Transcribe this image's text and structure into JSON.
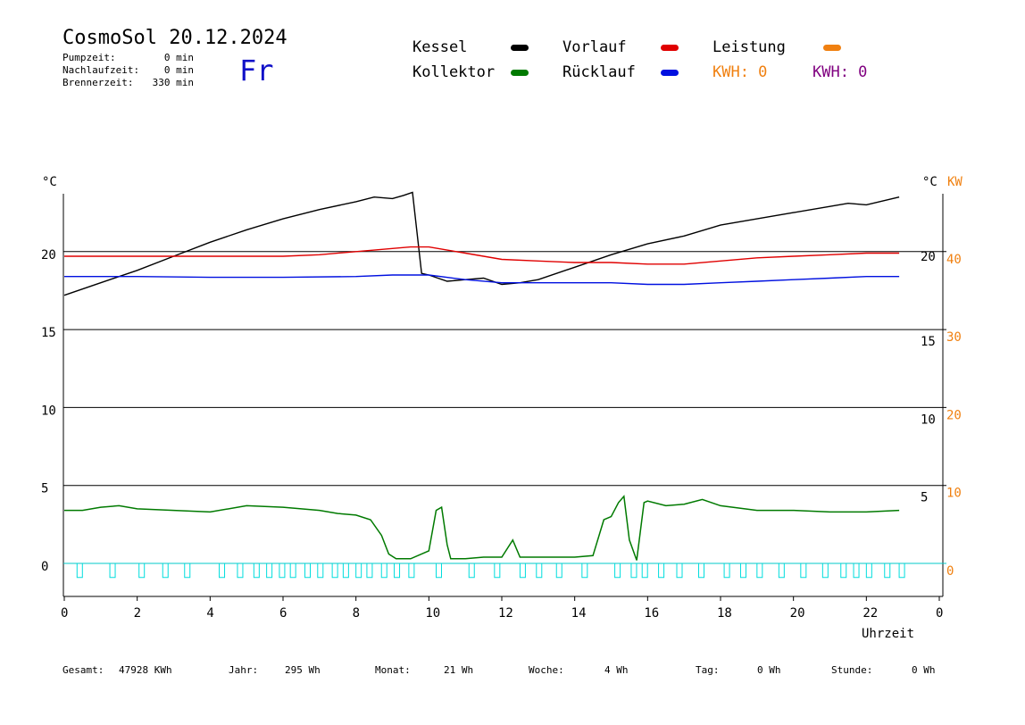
{
  "header": {
    "title": "CosmoSol 20.12.2024",
    "day": "Fr",
    "stats": [
      {
        "label": "Pumpzeit:",
        "value": "0 min"
      },
      {
        "label": "Nachlaufzeit:",
        "value": "0 min"
      },
      {
        "label": "Brennerzeit:",
        "value": "330 min"
      }
    ]
  },
  "legend": {
    "kessel": {
      "label": "Kessel",
      "color": "#000000"
    },
    "vorlauf": {
      "label": "Vorlauf",
      "color": "#e00000"
    },
    "leistung": {
      "label": "Leistung",
      "color": "#f08010"
    },
    "kollektor": {
      "label": "Kollektor",
      "color": "#007a00"
    },
    "ruecklauf": {
      "label": "Rücklauf",
      "color": "#0010e0"
    },
    "kwh_orange": {
      "label": "KWH: 0",
      "color": "#f08010"
    },
    "kwh_purple": {
      "label": "KWH: 0",
      "color": "#800080"
    }
  },
  "footer": [
    {
      "label": "Gesamt:",
      "value": "47928 KWh"
    },
    {
      "label": "Jahr:",
      "value": "295 Wh"
    },
    {
      "label": "Monat:",
      "value": "21 Wh"
    },
    {
      "label": "Woche:",
      "value": "4 Wh"
    },
    {
      "label": "Tag:",
      "value": "0 Wh"
    },
    {
      "label": "Stunde:",
      "value": "0 Wh"
    }
  ],
  "chart_data": {
    "type": "line",
    "xlabel": "Uhrzeit",
    "xlim": [
      0,
      24
    ],
    "x_ticks": [
      "0",
      "2",
      "4",
      "6",
      "8",
      "10",
      "12",
      "14",
      "16",
      "18",
      "20",
      "22",
      "0"
    ],
    "left_axis": {
      "unit": "°C",
      "ticks": [
        "0",
        "5",
        "10",
        "15",
        "20"
      ],
      "ylim": [
        0,
        25
      ]
    },
    "right_axis_scaled": {
      "unit": "°C",
      "note_ticks": [
        "5",
        "10",
        "15",
        "20"
      ]
    },
    "right_axis_kw": {
      "unit": "KW",
      "ticks": [
        "0",
        "10",
        "20",
        "30",
        "40"
      ]
    },
    "series": [
      {
        "name": "Kessel",
        "color": "#000000",
        "x": [
          0,
          0.5,
          1,
          2,
          3,
          4,
          5,
          6,
          7,
          8,
          8.5,
          9,
          9.3,
          9.55,
          9.8,
          10,
          10.5,
          11,
          11.5,
          12,
          12.5,
          13,
          14,
          15,
          16,
          17,
          18,
          19,
          20,
          21,
          21.5,
          22,
          22.9
        ],
        "y": [
          17.2,
          17.6,
          18.0,
          18.8,
          19.7,
          20.6,
          21.4,
          22.1,
          22.7,
          23.2,
          23.5,
          23.4,
          23.6,
          23.8,
          18.6,
          18.5,
          18.1,
          18.2,
          18.3,
          17.9,
          18.0,
          18.2,
          19.0,
          19.8,
          20.5,
          21.0,
          21.7,
          22.1,
          22.5,
          22.9,
          23.1,
          23.0,
          23.5
        ]
      },
      {
        "name": "Vorlauf",
        "color": "#e00000",
        "x": [
          0,
          2,
          4,
          6,
          7,
          8,
          9,
          9.5,
          10,
          10.5,
          11,
          12,
          13,
          14,
          15,
          16,
          17,
          18,
          19,
          20,
          21,
          22,
          22.9
        ],
        "y": [
          19.7,
          19.7,
          19.7,
          19.7,
          19.8,
          20.0,
          20.2,
          20.3,
          20.3,
          20.1,
          19.9,
          19.5,
          19.4,
          19.3,
          19.3,
          19.2,
          19.2,
          19.4,
          19.6,
          19.7,
          19.8,
          19.9,
          19.9
        ]
      },
      {
        "name": "Rücklauf",
        "color": "#0010e0",
        "x": [
          0,
          2,
          4,
          6,
          8,
          9,
          10,
          11,
          12,
          13,
          14,
          15,
          16,
          17,
          18,
          19,
          20,
          21,
          22,
          22.9
        ],
        "y": [
          18.4,
          18.4,
          18.35,
          18.35,
          18.4,
          18.5,
          18.5,
          18.2,
          18.0,
          18.0,
          18.0,
          18.0,
          17.9,
          17.9,
          18.0,
          18.1,
          18.2,
          18.3,
          18.4,
          18.4
        ]
      },
      {
        "name": "Kollektor",
        "color": "#007a00",
        "x": [
          0,
          0.5,
          1,
          1.5,
          2,
          3,
          4,
          5,
          6,
          7,
          7.5,
          8,
          8.4,
          8.7,
          8.9,
          9.1,
          9.5,
          10,
          10.2,
          10.35,
          10.5,
          10.6,
          11,
          11.5,
          12,
          12.3,
          12.5,
          13,
          14,
          14.5,
          14.8,
          15,
          15.2,
          15.35,
          15.5,
          15.7,
          15.9,
          16,
          16.5,
          17,
          17.5,
          18,
          19,
          20,
          21,
          22,
          22.9
        ],
        "y": [
          3.4,
          3.4,
          3.6,
          3.7,
          3.5,
          3.4,
          3.3,
          3.7,
          3.6,
          3.4,
          3.2,
          3.1,
          2.8,
          1.8,
          0.6,
          0.3,
          0.3,
          0.8,
          3.4,
          3.6,
          1.2,
          0.3,
          0.3,
          0.4,
          0.4,
          1.5,
          0.4,
          0.4,
          0.4,
          0.5,
          2.8,
          3.0,
          3.9,
          4.3,
          1.5,
          0.2,
          3.9,
          4.0,
          3.7,
          3.8,
          4.1,
          3.7,
          3.4,
          3.4,
          3.3,
          3.3,
          3.4
        ]
      }
    ],
    "pump_pulses": {
      "color": "#00dddd",
      "x": [
        0.35,
        1.25,
        2.05,
        2.7,
        3.3,
        4.25,
        4.75,
        5.2,
        5.55,
        5.9,
        6.2,
        6.6,
        6.95,
        7.35,
        7.65,
        8.0,
        8.3,
        8.7,
        9.05,
        9.45,
        10.2,
        11.1,
        11.8,
        12.5,
        12.95,
        13.5,
        14.2,
        15.1,
        15.55,
        15.85,
        16.3,
        16.8,
        17.4,
        18.1,
        18.55,
        19.0,
        19.6,
        20.2,
        20.8,
        21.3,
        21.65,
        22.0,
        22.5,
        22.9
      ],
      "height": 0.9
    }
  }
}
